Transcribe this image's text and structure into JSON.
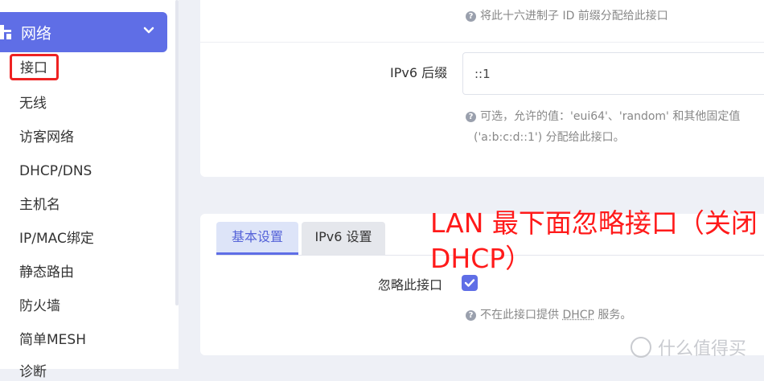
{
  "sidebar": {
    "group": {
      "label": "网络",
      "icon": "network-icon",
      "expand_icon": "chevron-down-icon"
    },
    "items": [
      {
        "label": "接口",
        "active": true
      },
      {
        "label": "无线"
      },
      {
        "label": "访客网络"
      },
      {
        "label": "DHCP/DNS"
      },
      {
        "label": "主机名"
      },
      {
        "label": "IP/MAC绑定"
      },
      {
        "label": "静态路由"
      },
      {
        "label": "防火墙"
      },
      {
        "label": "简单MESH"
      },
      {
        "label": "诊断"
      }
    ]
  },
  "ipv6_card": {
    "prefix_hint": "将此十六进制子 ID 前缀分配给此接口",
    "suffix_label": "IPv6 后缀",
    "suffix_value": "::1",
    "suffix_hint_line1": "可选，允许的值：'eui64'、'random' 和其他固定值",
    "suffix_hint_line2": "('a:b:c:d::1') 分配给此接口。"
  },
  "dhcp_card": {
    "tabs": [
      {
        "label": "基本设置",
        "active": true
      },
      {
        "label": "IPv6 设置",
        "active": false
      }
    ],
    "ignore_label": "忽略此接口",
    "ignore_checked": true,
    "ignore_hint_prefix": "不在此接口提供 ",
    "ignore_hint_link": "DHCP",
    "ignore_hint_suffix": " 服务。"
  },
  "annotation": {
    "line1": "LAN 最下面忽略接口（关闭",
    "line2": "DHCP）",
    "color": "#ff1a1a"
  },
  "watermark": {
    "text": "什么值得买"
  },
  "colors": {
    "accent": "#5f6ee6",
    "highlight_box": "#ee2222"
  }
}
